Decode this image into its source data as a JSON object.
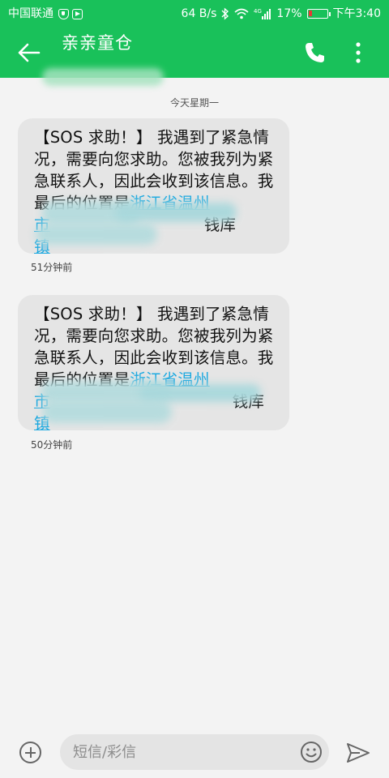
{
  "status_bar": {
    "carrier": "中国联通",
    "net_speed": "64 B/s",
    "signal_label": "4G",
    "battery": "17%",
    "battery_level": 0.17,
    "battery_color": "#e53935",
    "time": "下午3:40",
    "icons": [
      "shield-icon",
      "play-icon",
      "bluetooth-icon",
      "wifi-icon",
      "signal-icon",
      "battery-icon"
    ]
  },
  "header": {
    "title": "亲亲童仓",
    "subtitle": "",
    "icons": [
      "back-arrow-icon",
      "phone-icon",
      "more-vert-icon"
    ],
    "accent": "#19c15a"
  },
  "conversation": {
    "day_label": "今天星期一",
    "messages": [
      {
        "text_before_link": "【SOS 求助！】 我遇到了紧急情况，需要向您求助。您被我列为紧急联系人，因此会收到该信息。我最后的位置是",
        "link_parts": [
          "浙江省温州",
          "市",
          "钱库",
          "镇"
        ],
        "time": "51分钟前"
      },
      {
        "text_before_link": "【SOS 求助！】 我遇到了紧急情况，需要向您求助。您被我列为紧急联系人，因此会收到该信息。我最后的位置是",
        "link_parts": [
          "浙江省温州",
          "市",
          "钱库",
          "镇"
        ],
        "time": "50分钟前"
      }
    ]
  },
  "composer": {
    "placeholder": "短信/彩信",
    "value": "",
    "icons": [
      "add-icon",
      "emoji-icon",
      "send-icon"
    ]
  }
}
